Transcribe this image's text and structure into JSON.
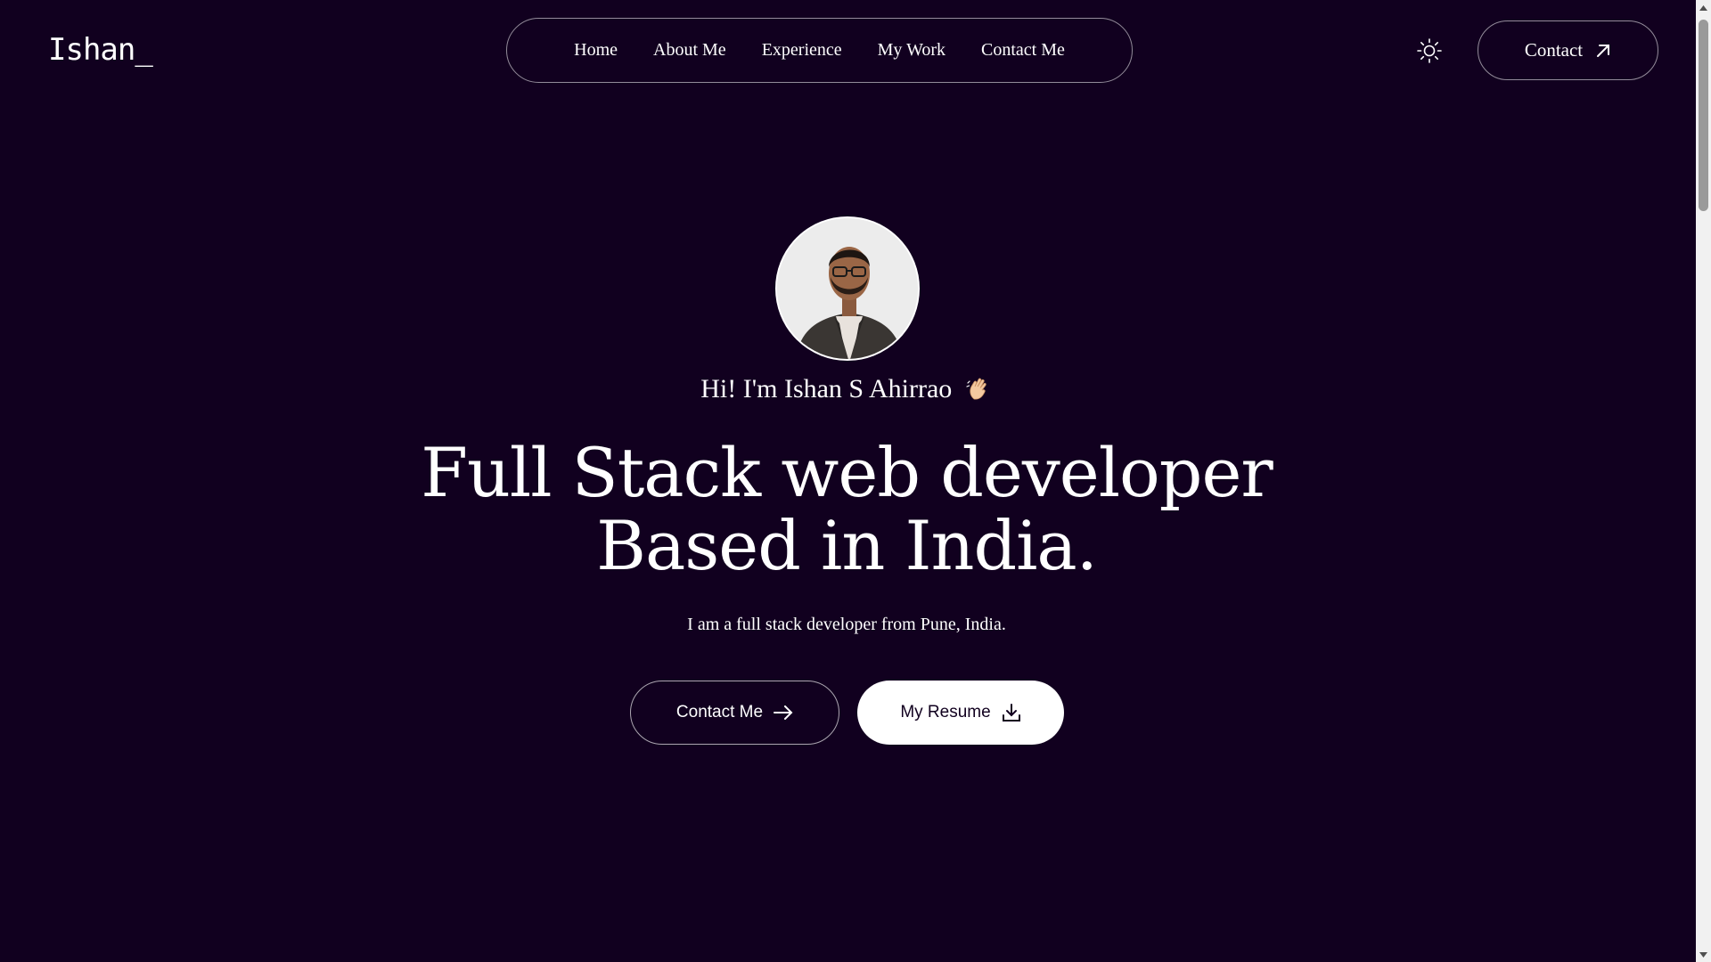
{
  "header": {
    "logo": "Ishan_",
    "nav": [
      "Home",
      "About Me",
      "Experience",
      "My Work",
      "Contact Me"
    ],
    "theme_toggle_icon": "sun-icon",
    "contact_label": "Contact",
    "contact_icon": "arrow-up-right-icon"
  },
  "hero": {
    "greeting": "Hi! I'm Ishan S Ahirrao",
    "greeting_icon": "waving-hand-icon",
    "headline_line1": "Full Stack web developer",
    "headline_line2": "Based in India.",
    "subtext": "I am a full stack developer from Pune, India.",
    "primary_button": "Contact Me",
    "primary_button_icon": "arrow-right-icon",
    "secondary_button": "My Resume",
    "secondary_button_icon": "download-icon"
  },
  "colors": {
    "background": "#11001f",
    "text": "#ffffff",
    "button_fill": "#ffffff"
  }
}
